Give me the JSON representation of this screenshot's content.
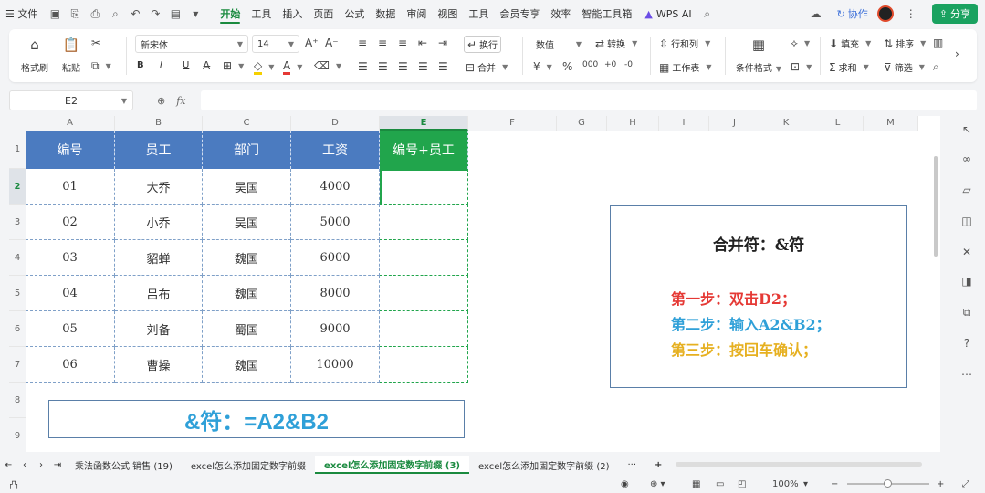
{
  "menubar": {
    "menu_label": "☰ 文件",
    "tabs": [
      "开始",
      "插入",
      "页面",
      "公式",
      "数据",
      "审阅",
      "视图",
      "工具",
      "会员专享",
      "效率",
      "智能工具箱"
    ],
    "tools_tab": "工具",
    "active_tab": "开始",
    "ai_label": "WPS AI",
    "collab_label": "协作",
    "share_label": "分享"
  },
  "ribbon": {
    "format_painter": "格式刷",
    "paste": "粘贴",
    "font_name": "新宋体",
    "font_size": "14",
    "wrap": "换行",
    "merge": "合并",
    "number_format": "数值",
    "convert": "转换",
    "row_col": "行和列",
    "worksheet": "工作表",
    "cond_format": "条件格式",
    "fill": "填充",
    "sort": "排序",
    "sum": "求和",
    "filter": "筛选",
    "bold": "B",
    "italic": "I",
    "underline": "U"
  },
  "formulabar": {
    "cell_ref": "E2",
    "fx": "fx"
  },
  "grid": {
    "columns": [
      "A",
      "B",
      "C",
      "D",
      "E",
      "F",
      "G",
      "H",
      "I",
      "J",
      "K",
      "L",
      "M"
    ],
    "rows": [
      "1",
      "2",
      "3",
      "4",
      "5",
      "6",
      "7",
      "8",
      "9"
    ],
    "header": [
      "编号",
      "员工",
      "部门",
      "工资",
      "编号+员工"
    ],
    "data": [
      [
        "01",
        "大乔",
        "吴国",
        "4000",
        ""
      ],
      [
        "02",
        "小乔",
        "吴国",
        "5000",
        ""
      ],
      [
        "03",
        "貂蝉",
        "魏国",
        "6000",
        ""
      ],
      [
        "04",
        "吕布",
        "魏国",
        "8000",
        ""
      ],
      [
        "05",
        "刘备",
        "蜀国",
        "9000",
        ""
      ],
      [
        "06",
        "曹操",
        "魏国",
        "10000",
        ""
      ]
    ],
    "banner": "&符：=A2&B2",
    "note": {
      "title": "合并符：&符",
      "steps": [
        "第一步：双击D2；",
        "第二步：输入A2&B2；",
        "第三步：按回车确认；"
      ]
    }
  },
  "colors": {
    "header_blue": "#4b7bc0",
    "header_green": "#21a54c",
    "step1": "#e53935",
    "step2": "#2fa0d8",
    "step3": "#e6b020",
    "banner": "#2fa0d8"
  },
  "sheets": {
    "tabs": [
      "乘法函数公式 销售 (19)",
      "excel怎么添加固定数字前缀",
      "excel怎么添加固定数字前缀 (3)",
      "excel怎么添加固定数字前缀 (2)"
    ],
    "active": "excel怎么添加固定数字前缀 (3)",
    "more": "···",
    "add": "+"
  },
  "status": {
    "left": "凸",
    "zoom": "100%"
  }
}
